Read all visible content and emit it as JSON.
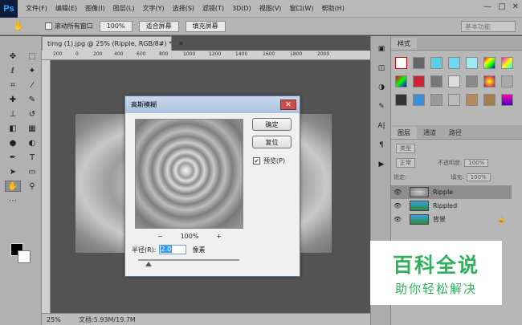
{
  "app": {
    "logo": "Ps"
  },
  "menu": [
    "文件(F)",
    "编辑(E)",
    "图像(I)",
    "图层(L)",
    "文字(Y)",
    "选择(S)",
    "滤镜(T)",
    "3D(D)",
    "视图(V)",
    "窗口(W)",
    "帮助(H)"
  ],
  "window_controls": [
    "—",
    "□",
    "✕"
  ],
  "options": {
    "tool_icon": "hand-icon",
    "scroll_all_label": "滚动所有窗口",
    "zoom_value": "100%",
    "fit_screen": "适合屏幕",
    "fill_screen": "填充屏幕",
    "workspace": "基本功能"
  },
  "document": {
    "tab_title": "timg (1).jpg @ 25% (Ripple, RGB/8#) *",
    "ruler_ticks": [
      "200",
      "0",
      "200",
      "400",
      "600",
      "800",
      "1000",
      "1200",
      "1400",
      "1600",
      "1800",
      "2000"
    ],
    "status_zoom": "25%",
    "status_doc": "文档:5.93M/19.7M"
  },
  "panels": {
    "styles_tabs": [
      "样式"
    ],
    "layers_tabs": [
      "图层",
      "通道",
      "路径"
    ],
    "filter_kind": "类型",
    "blend_mode": "正常",
    "opacity_label": "不透明度:",
    "opacity_value": "100%",
    "lock_label": "锁定:",
    "fill_label": "填充:",
    "fill_value": "100%",
    "layers": [
      {
        "name": "Ripple",
        "selected": true,
        "locked": false
      },
      {
        "name": "Rippled",
        "selected": false,
        "locked": false
      },
      {
        "name": "背景",
        "selected": false,
        "locked": true
      }
    ]
  },
  "dialog": {
    "title": "高斯模糊",
    "ok": "确定",
    "reset": "复位",
    "preview_label": "预览(P)",
    "preview_checked": "✔",
    "zoom_out": "−",
    "zoom_value": "100%",
    "zoom_in": "+",
    "radius_label": "半径(R):",
    "radius_value": "2.0",
    "radius_unit": "像素",
    "close": "✕"
  },
  "watermark": {
    "title": "百科全说",
    "subtitle": "助你轻松解决"
  },
  "colors": {
    "accent": "#2eb15a",
    "ps_blue": "#31a8ff"
  }
}
